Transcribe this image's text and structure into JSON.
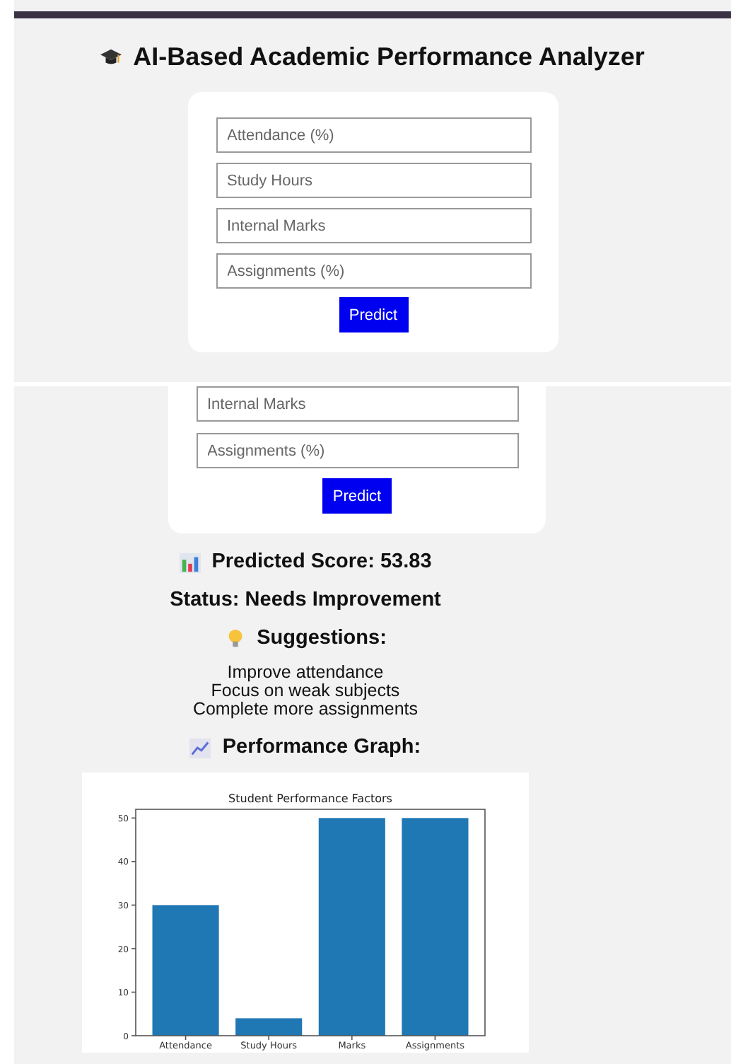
{
  "screens": [
    {
      "kind": "form",
      "title": "AI-Based Academic Performance Analyzer",
      "fields": [
        {
          "placeholder": "Attendance (%)"
        },
        {
          "placeholder": "Study Hours"
        },
        {
          "placeholder": "Internal Marks"
        },
        {
          "placeholder": "Assignments (%)"
        }
      ],
      "button": "Predict"
    },
    {
      "kind": "results",
      "fields": [
        {
          "placeholder": "Internal Marks"
        },
        {
          "placeholder": "Assignments (%)"
        }
      ],
      "button": "Predict",
      "score": "Predicted Score: 53.83",
      "status": "Status: Needs Improvement",
      "suggestions_heading": "Suggestions:",
      "suggestions": [
        "Improve attendance",
        "Focus on weak subjects",
        "Complete more assignments"
      ],
      "graph_heading": "Performance Graph:",
      "chart_data": {
        "type": "bar",
        "title": "Student Performance Factors",
        "categories": [
          "Attendance",
          "Study Hours",
          "Marks",
          "Assignments"
        ],
        "values": [
          30,
          4,
          50,
          50
        ],
        "ylim": [
          0,
          52
        ],
        "yticks": [
          0,
          10,
          20,
          30,
          40,
          50
        ]
      }
    }
  ]
}
